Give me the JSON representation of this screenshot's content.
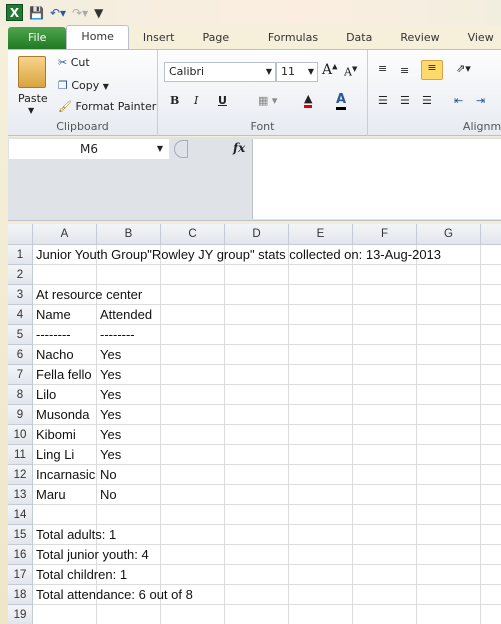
{
  "app": {
    "icon": "excel-icon",
    "qat": [
      "save-icon",
      "undo-icon",
      "redo-icon",
      "customize-qat-icon"
    ]
  },
  "tabs": [
    {
      "label": "File"
    },
    {
      "label": "Home",
      "active": true
    },
    {
      "label": "Insert"
    },
    {
      "label": "Page Layout"
    },
    {
      "label": "Formulas"
    },
    {
      "label": "Data"
    },
    {
      "label": "Review"
    },
    {
      "label": "View"
    }
  ],
  "ribbon": {
    "clipboard": {
      "label": "Clipboard",
      "paste": "Paste",
      "cut": "Cut",
      "copy": "Copy",
      "format_painter": "Format Painter"
    },
    "font": {
      "label": "Font",
      "font_name": "Calibri",
      "font_size": "11",
      "bold": "B",
      "italic": "I",
      "underline": "U",
      "fill_color": "#e00000",
      "font_color": "#000000"
    },
    "alignment": {
      "label": "Alignme"
    }
  },
  "formula_bar": {
    "name_box": "M6",
    "fx": "fx",
    "formula": ""
  },
  "columns": [
    "A",
    "B",
    "C",
    "D",
    "E",
    "F",
    "G",
    ""
  ],
  "rows": [
    {
      "n": "1",
      "a": "Junior Youth Group\"Rowley JY group\" stats collected on: 13-Aug-2013",
      "b": ""
    },
    {
      "n": "2",
      "a": "",
      "b": ""
    },
    {
      "n": "3",
      "a": "At resource center",
      "b": ""
    },
    {
      "n": "4",
      "a": "Name",
      "b": "Attended"
    },
    {
      "n": "5",
      "a": "--------",
      "b": "--------"
    },
    {
      "n": "6",
      "a": "Nacho",
      "b": "Yes"
    },
    {
      "n": "7",
      "a": "Fella fello",
      "b": "Yes"
    },
    {
      "n": "8",
      "a": "Lilo",
      "b": "Yes"
    },
    {
      "n": "9",
      "a": "Musonda",
      "b": "Yes"
    },
    {
      "n": "10",
      "a": "Kibomi",
      "b": "Yes"
    },
    {
      "n": "11",
      "a": "Ling Li",
      "b": "Yes"
    },
    {
      "n": "12",
      "a": "Incarnasic",
      "b": "No"
    },
    {
      "n": "13",
      "a": "Maru",
      "b": "No"
    },
    {
      "n": "14",
      "a": "",
      "b": ""
    },
    {
      "n": "15",
      "a": "Total adults: 1",
      "b": ""
    },
    {
      "n": "16",
      "a": "Total junior youth: 4",
      "b": ""
    },
    {
      "n": "17",
      "a": "Total children: 1",
      "b": ""
    },
    {
      "n": "18",
      "a": "Total attendance: 6 out of 8",
      "b": ""
    },
    {
      "n": "19",
      "a": "",
      "b": ""
    }
  ]
}
